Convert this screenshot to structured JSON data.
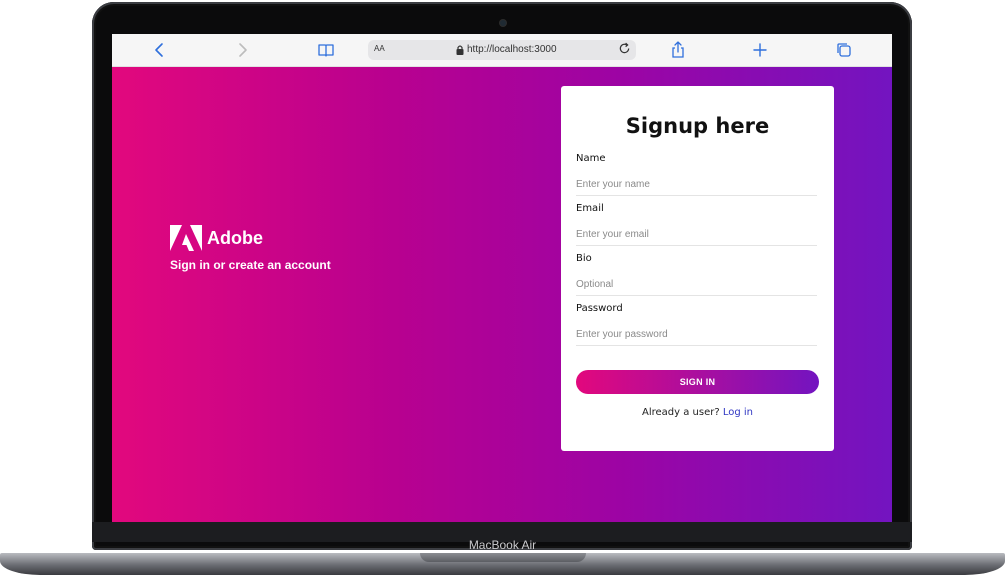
{
  "device": {
    "label": "MacBook Air"
  },
  "browser": {
    "text_size_label": "AA",
    "url": "http://localhost:3000",
    "icons": {
      "back": "chevron-left-icon",
      "forward": "chevron-right-icon",
      "bookmarks": "book-icon",
      "share": "share-icon",
      "new_tab": "plus-icon",
      "tabs": "tabs-icon",
      "reload": "reload-icon",
      "lock": "lock-icon"
    },
    "accent_color": "#2f6fdc"
  },
  "brand": {
    "name": "Adobe",
    "tagline": "Sign in or create an account"
  },
  "theme": {
    "gradient_start": "#e2087d",
    "gradient_end": "#7314c0"
  },
  "signup": {
    "title": "Signup here",
    "fields": [
      {
        "label": "Name",
        "placeholder": "Enter your name",
        "value": ""
      },
      {
        "label": "Email",
        "placeholder": "Enter your email",
        "value": ""
      },
      {
        "label": "Bio",
        "placeholder": "Optional",
        "value": ""
      },
      {
        "label": "Password",
        "placeholder": "Enter your password",
        "value": ""
      }
    ],
    "submit_label": "SIGN IN",
    "login_prompt": "Already a user?",
    "login_link": "Log in"
  }
}
